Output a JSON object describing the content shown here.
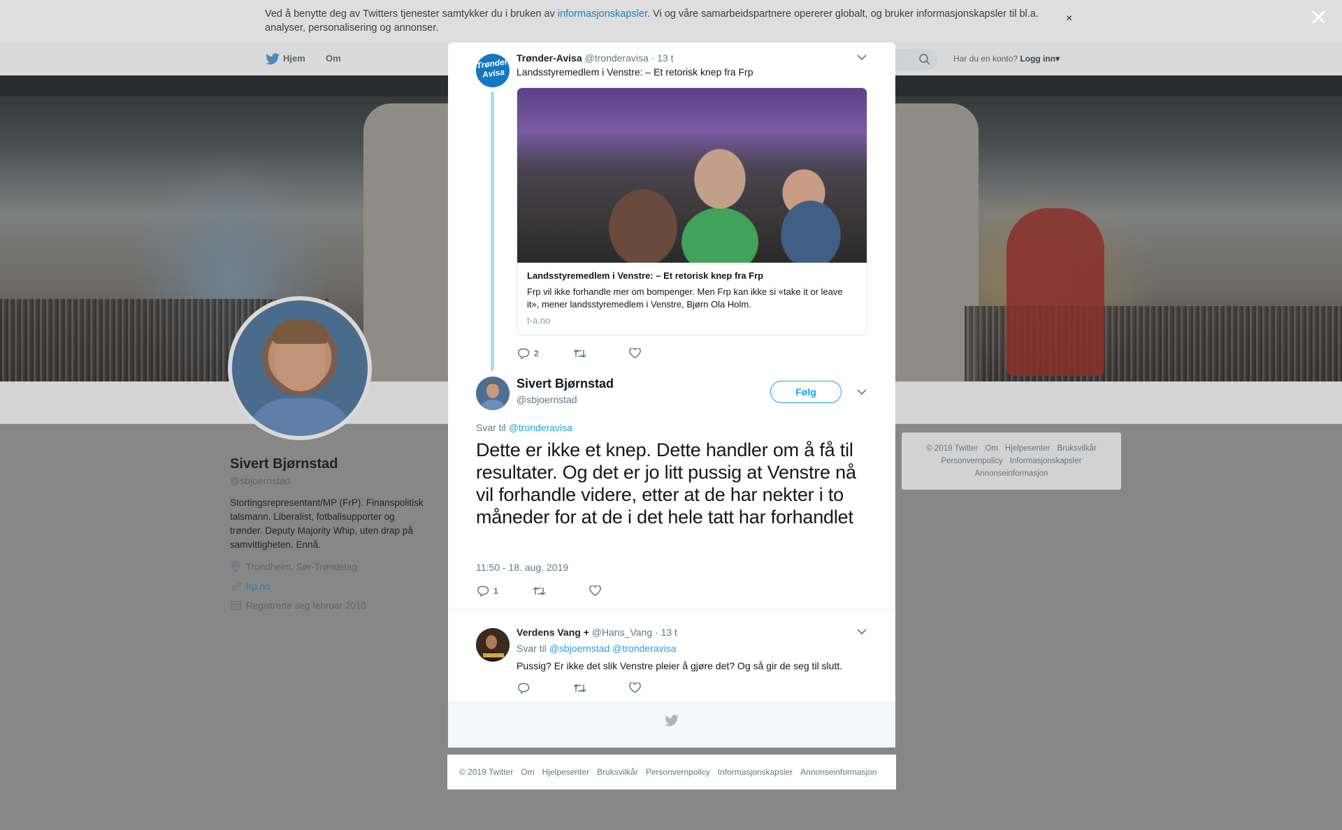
{
  "cookie": {
    "text_before": "Ved å benytte deg av Twitters tjenester samtykker du i bruken av ",
    "link": "informasjonskapsler",
    "text_after": ". Vi og våre samarbeidspartnere opererer globalt, og bruker informasjonskapsler til bl.a. analyser, personalisering og annonser.",
    "close": "×"
  },
  "nav": {
    "home": "Hjem",
    "about": "Om",
    "account_question": "Har du en konto?",
    "login": "Logg inn",
    "login_caret": "▾"
  },
  "profile": {
    "name": "Sivert Bjørnstad",
    "handle": "@sbjoernstad",
    "bio": "Stortingsrepresentant/MP (FrP). Finanspolitisk talsmann. Liberalist, fotballsupporter og trønder. Deputy Majority Whip, uten drap på samvittigheten. Ennå.",
    "location": "Trondheim, Sør-Trøndelag",
    "url": "frp.no",
    "joined": "Registrerte seg februar 2010"
  },
  "side_footer": {
    "links": [
      "© 2019 Twitter",
      "Om",
      "Hjelpesenter",
      "Bruksvilkår",
      "Personvernpolicy",
      "Informasjonskapsler",
      "Annonseinformasjon"
    ]
  },
  "overlay_close": "✕",
  "parent_tweet": {
    "avatar_text": "Trønder Avisa",
    "name": "Trønder-Avisa",
    "handle": "@tronderavisa",
    "time": "· 13 t",
    "text": "Landsstyremedlem i Venstre: – Et retorisk knep fra Frp",
    "card": {
      "title": "Landsstyremedlem i Venstre: – Et retorisk knep fra Frp",
      "description": "Frp vil ikke forhandle mer om bompenger. Men Frp kan ikke si «take it or leave it», mener landsstyremedlem i Venstre, Bjørn Ola Holm.",
      "domain": "t-a.no"
    },
    "reply_count": "2"
  },
  "main_tweet": {
    "name": "Sivert Bjørnstad",
    "handle": "@sbjoernstad",
    "follow": "Følg",
    "reply_to_label": "Svar til ",
    "reply_to": "@tronderavisa",
    "text": "Dette er ikke et knep. Dette handler om å få til resultater. Og det er jo litt pussig at Venstre nå vil forhandle videre, etter at de har nekter i to måneder for at de i det hele tatt har forhandlet",
    "timestamp": "11:50 - 18. aug. 2019",
    "reply_count": "1"
  },
  "reply_tweet": {
    "name": "Verdens Vang +",
    "handle": "@Hans_Vang",
    "time": "· 13 t",
    "reply_to_label": "Svar til ",
    "reply_to_1": "@sbjoernstad",
    "reply_to_2": "@tronderavisa",
    "text": "Pussig? Er ikke det slik Venstre pleier å gjøre det? Og så gir de seg til slutt."
  },
  "bottom_footer": {
    "links": [
      "© 2019 Twitter",
      "Om",
      "Hjelpesenter",
      "Bruksvilkår",
      "Personvernpolicy",
      "Informasjonskapsler",
      "Annonseinformasjon"
    ]
  },
  "icons": {
    "caret": "chevron-down-icon",
    "twitter": "twitter-bird-icon",
    "reply": "reply-icon",
    "retweet": "retweet-icon",
    "like": "heart-icon"
  },
  "colors": {
    "twitter_blue": "#1da1f2",
    "link_blue": "#1f7fb8",
    "modal_bg": "#ffffff",
    "overlay_bg": "#878787"
  }
}
